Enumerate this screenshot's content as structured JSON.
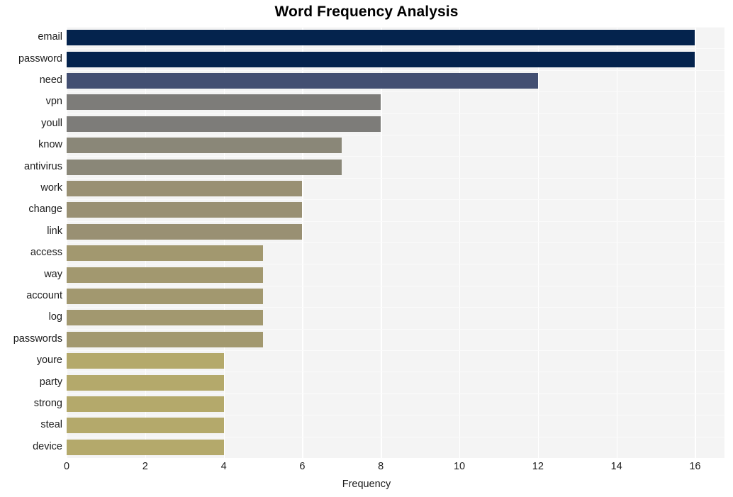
{
  "chart_data": {
    "type": "bar",
    "orientation": "horizontal",
    "title": "Word Frequency Analysis",
    "xlabel": "Frequency",
    "ylabel": "",
    "categories": [
      "email",
      "password",
      "need",
      "vpn",
      "youll",
      "know",
      "antivirus",
      "work",
      "change",
      "link",
      "access",
      "way",
      "account",
      "log",
      "passwords",
      "youre",
      "party",
      "strong",
      "steal",
      "device"
    ],
    "values": [
      16,
      16,
      12,
      8,
      8,
      7,
      7,
      6,
      6,
      6,
      5,
      5,
      5,
      5,
      5,
      4,
      4,
      4,
      4,
      4
    ],
    "bar_colors": [
      "#04234d",
      "#04234d",
      "#434f72",
      "#7d7c79",
      "#7d7c79",
      "#8a8778",
      "#8a8778",
      "#999073",
      "#999073",
      "#999073",
      "#a2986f",
      "#a2986f",
      "#a2986f",
      "#a2986f",
      "#a2986f",
      "#b4a96b",
      "#b4a96b",
      "#b4a96b",
      "#b4a96b",
      "#b4a96b"
    ],
    "xlim": [
      0,
      16.75
    ],
    "xticks": [
      0,
      2,
      4,
      6,
      8,
      10,
      12,
      14,
      16
    ],
    "xtick_labels": [
      "0",
      "2",
      "4",
      "6",
      "8",
      "10",
      "12",
      "14",
      "16"
    ],
    "grid": true,
    "grid_axis": "both",
    "legend": null,
    "plot_background": "#f4f4f4",
    "figure_background": "#ffffff",
    "grid_color": "#ffffff",
    "text_color": "#1c1c1c",
    "title_color": "#000000"
  }
}
